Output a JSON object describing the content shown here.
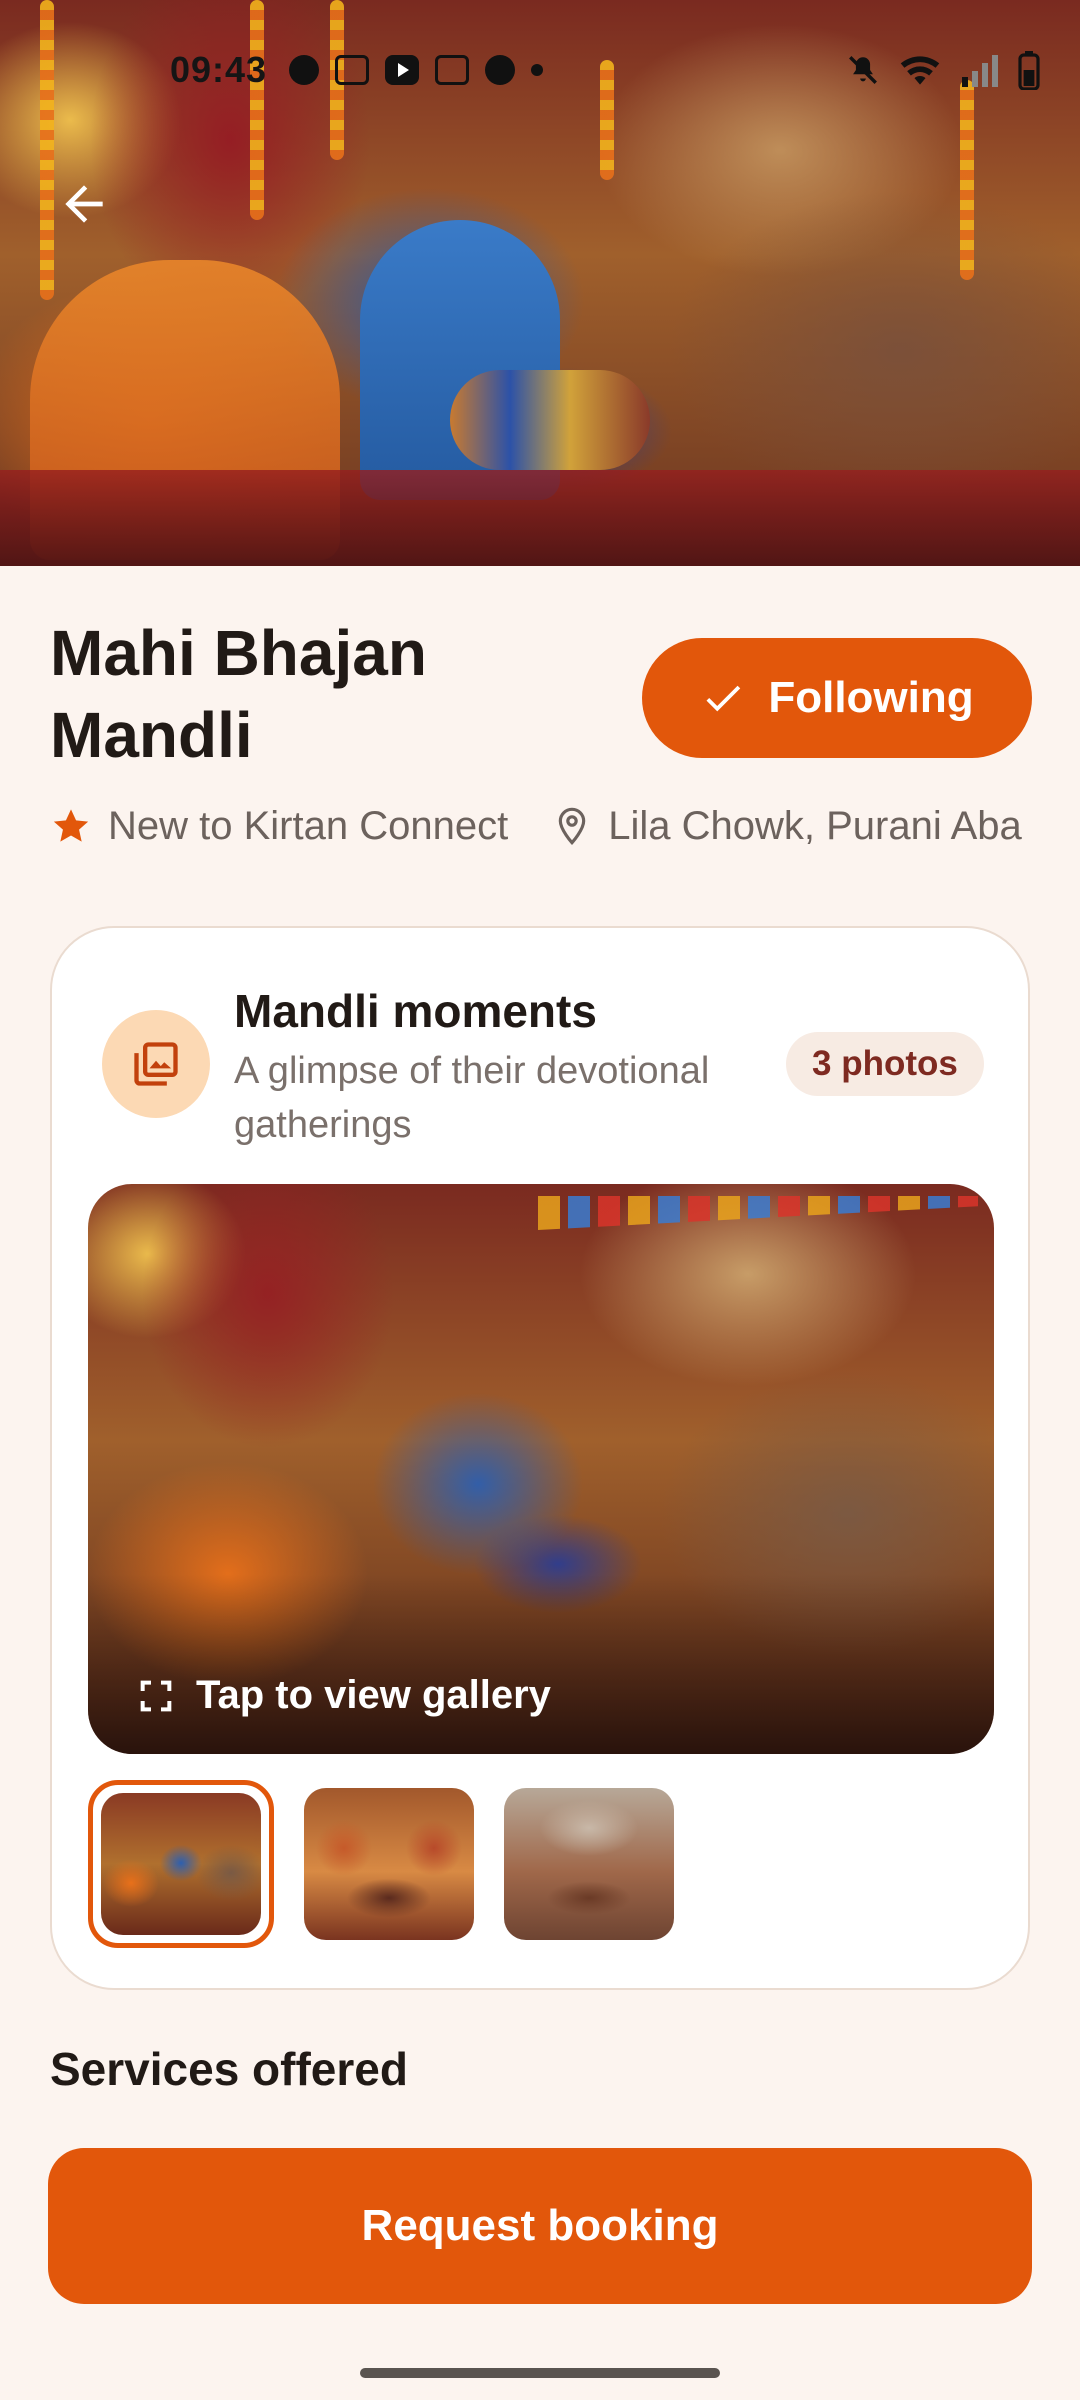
{
  "status_bar": {
    "time": "09:43"
  },
  "profile": {
    "name": "Mahi Bhajan Mandli",
    "follow_label": "Following",
    "badge_text": "New to Kirtan Connect",
    "location": "Lila Chowk, Purani Aba"
  },
  "moments": {
    "title": "Mandli moments",
    "subtitle": "A glimpse of their devotional gatherings",
    "photo_count": "3 photos",
    "gallery_hint": "Tap to view gallery",
    "thumbnails": [
      {
        "selected": true
      },
      {
        "selected": false
      },
      {
        "selected": false
      }
    ]
  },
  "services": {
    "heading": "Services offered"
  },
  "booking": {
    "cta_label": "Request booking"
  },
  "colors": {
    "accent": "#e2570b",
    "background": "#fcf4ef",
    "badge_text": "#7e2a21",
    "icon_bg": "#fcd9b4"
  },
  "icons": {
    "back": "arrow-left-icon",
    "follow": "check-icon",
    "badge": "star-icon",
    "location": "location-pin-icon",
    "moments": "photo-library-icon",
    "gallery": "fullscreen-icon"
  }
}
